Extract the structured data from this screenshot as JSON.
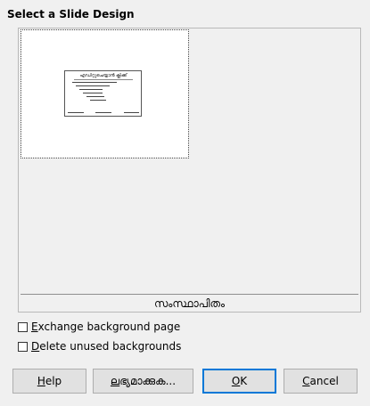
{
  "dialog": {
    "section_title": "Select a Slide Design"
  },
  "design_list": {
    "selected_design": "സംസ്ഥാപിതം",
    "thumbnail_title": "എഡിറ്റുചെയ്യാന്‍ ക്ലിക്ക്"
  },
  "options": {
    "exchange_background": {
      "mnemonic": "E",
      "rest": "xchange background page",
      "checked": false
    },
    "delete_unused": {
      "mnemonic": "D",
      "rest": "elete unused backgrounds",
      "checked": false
    }
  },
  "buttons": {
    "help": {
      "mnemonic": "H",
      "rest": "elp"
    },
    "load": {
      "mnemonic": "ല",
      "rest": "ഭ്യമാക്കുക..."
    },
    "ok": {
      "mnemonic": "O",
      "rest": "K"
    },
    "cancel": {
      "mnemonic": "C",
      "rest": "ancel"
    }
  },
  "colors": {
    "focus_border": "#0078d7",
    "dialog_background": "#f0f0f0"
  }
}
